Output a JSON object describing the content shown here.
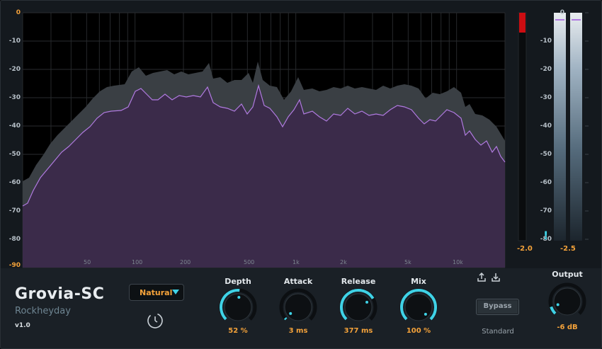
{
  "plugin": {
    "name": "Grovia-SC",
    "vendor": "Rockheyday",
    "version": "v1.0"
  },
  "spectrum": {
    "y_labels": [
      "0",
      "-10",
      "-20",
      "-30",
      "-40",
      "-50",
      "-60",
      "-70",
      "-80",
      "-90"
    ],
    "x_labels": [
      "50",
      "100",
      "200",
      "500",
      "1k",
      "2k",
      "5k",
      "10k"
    ],
    "fill_color": "#3b2b4a",
    "line_color": "#b07ae0",
    "peak_color": "#3a3f44"
  },
  "input_meter": {
    "value": "-2.0",
    "clip_color": "#cc0d12"
  },
  "output_meter": {
    "value": "-2.5",
    "warning": "!",
    "y_labels": [
      "0",
      "-10",
      "-20",
      "-30",
      "-40",
      "-50",
      "-60",
      "-70",
      "-80"
    ],
    "peak_color": "#b07ae0"
  },
  "mode_dropdown": {
    "selected": "Natural",
    "arrow_icon": "triangle-down-icon"
  },
  "knobs": [
    {
      "id": "depth",
      "label": "Depth",
      "value": "52 %",
      "level": 0.52
    },
    {
      "id": "attack",
      "label": "Attack",
      "value": "3 ms",
      "level": 0.02
    },
    {
      "id": "release",
      "label": "Release",
      "value": "377 ms",
      "level": 0.72
    },
    {
      "id": "mix",
      "label": "Mix",
      "value": "100 %",
      "level": 1.0
    }
  ],
  "bypass": {
    "label": "Bypass"
  },
  "quality": {
    "label": "Standard"
  },
  "output": {
    "label": "Output",
    "value": "-6 dB",
    "level": 0.1
  },
  "accent_color": "#3fd2e6",
  "value_color": "#f4a23a"
}
